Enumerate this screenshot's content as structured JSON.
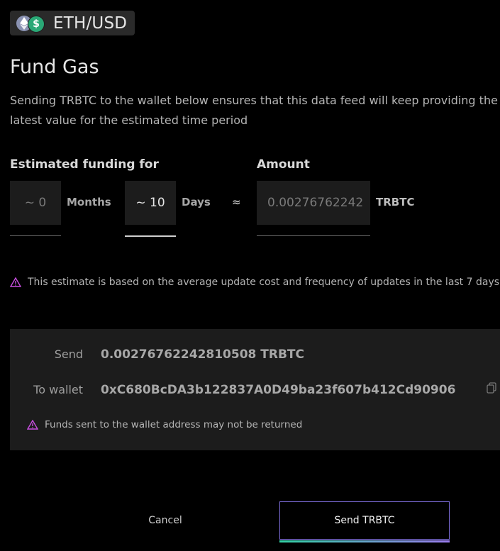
{
  "header": {
    "pair": "ETH/USD",
    "eth_icon": "eth-icon",
    "usd_icon": "usd-icon",
    "usd_symbol": "$"
  },
  "title": "Fund Gas",
  "description": "Sending TRBTC to the wallet below ensures that this data feed will keep providing the latest value for the estimated time period",
  "funding": {
    "label": "Estimated funding for",
    "months_value": "~ 0",
    "months_unit": "Months",
    "days_value": "~ 10",
    "days_unit": "Days",
    "approx": "≈",
    "amount_label": "Amount",
    "amount_value": "0.00276762242",
    "amount_unit": "TRBTC"
  },
  "estimate_note": "This estimate is based on the average update cost and frequency of updates in the last 7 days",
  "send": {
    "send_label": "Send",
    "send_value": "0.00276762242810508 TRBTC",
    "wallet_label": "To wallet",
    "wallet_value": "0xC680BcDA3b122837A0D49ba23f607b412Cd90906",
    "warning": "Funds sent to the wallet address may not be returned"
  },
  "actions": {
    "cancel": "Cancel",
    "send": "Send TRBTC"
  },
  "colors": {
    "warning": "#c84fe0",
    "accent_border": "#7b6bd6",
    "usd_green": "#2aa876"
  }
}
